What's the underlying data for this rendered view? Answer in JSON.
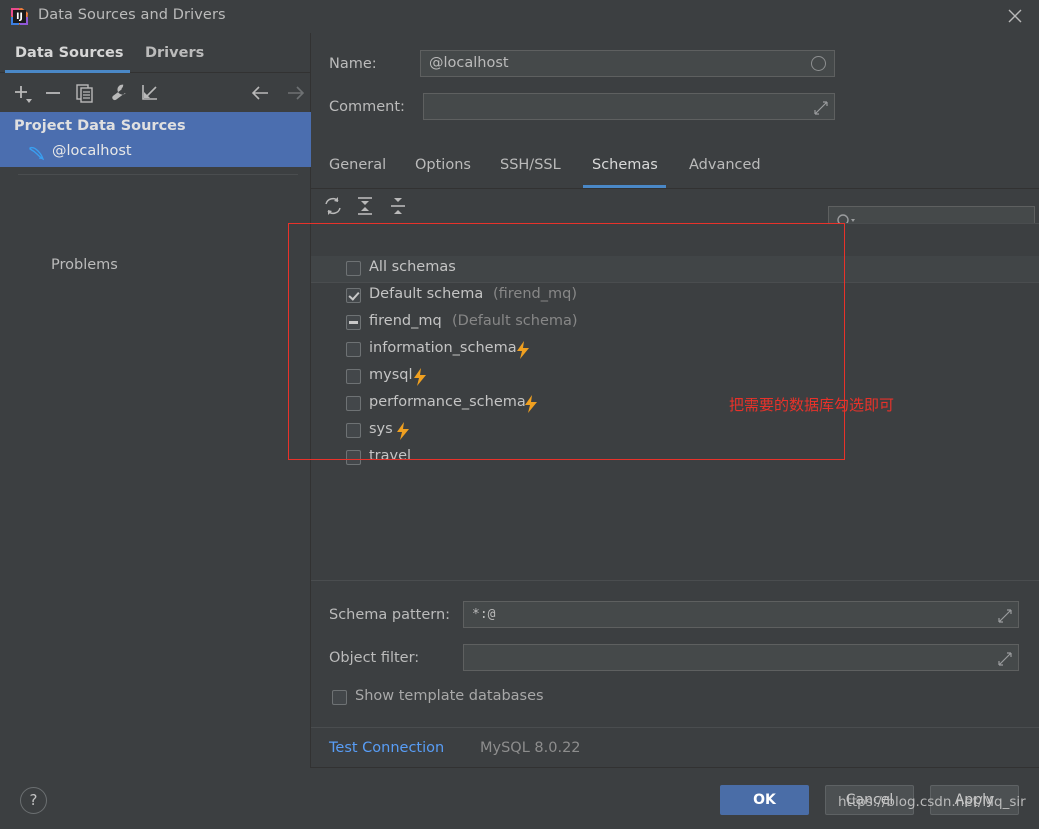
{
  "window": {
    "title": "Data Sources and Drivers",
    "app_icon": "intellij-idea-icon",
    "close_icon": "close-icon"
  },
  "sidebar": {
    "tabs": [
      {
        "label": "Data Sources",
        "selected": true
      },
      {
        "label": "Drivers",
        "selected": false
      }
    ],
    "toolbar": [
      {
        "name": "add-icon",
        "title": "Add"
      },
      {
        "name": "remove-icon",
        "title": "Remove"
      },
      {
        "name": "copy-icon",
        "title": "Duplicate"
      },
      {
        "name": "wrench-icon",
        "title": "Properties"
      },
      {
        "name": "import-icon",
        "title": "Import"
      },
      {
        "name": "arrow-left-icon",
        "title": "Back"
      },
      {
        "name": "arrow-right-icon",
        "title": "Forward"
      }
    ],
    "group_label": "Project Data Sources",
    "datasource": {
      "label": "@localhost",
      "icon": "mysql-dolphin-icon",
      "selected": true
    },
    "problems_label": "Problems"
  },
  "form": {
    "name_label": "Name:",
    "name_value": "@localhost",
    "comment_label": "Comment:",
    "comment_value": ""
  },
  "tabs": [
    {
      "label": "General",
      "selected": false
    },
    {
      "label": "Options",
      "selected": false
    },
    {
      "label": "SSH/SSL",
      "selected": false
    },
    {
      "label": "Schemas",
      "selected": true
    },
    {
      "label": "Advanced",
      "selected": false
    }
  ],
  "schemas_panel": {
    "toolbar": [
      {
        "name": "refresh-icon",
        "title": "Refresh"
      },
      {
        "name": "expand-all-icon",
        "title": "Expand All"
      },
      {
        "name": "collapse-all-icon",
        "title": "Collapse All"
      }
    ],
    "search_placeholder": "",
    "search_icon": "search-icon",
    "rows": [
      {
        "label": "All schemas",
        "sub": "",
        "state": "unchecked",
        "bolt": false,
        "header": true
      },
      {
        "label": "Default schema",
        "sub": "(firend_mq)",
        "state": "checked",
        "bolt": false,
        "header": false
      },
      {
        "label": "firend_mq",
        "sub": "(Default schema)",
        "state": "partial",
        "bolt": false,
        "header": false
      },
      {
        "label": "information_schema",
        "sub": "",
        "state": "unchecked",
        "bolt": true,
        "header": false
      },
      {
        "label": "mysql",
        "sub": "",
        "state": "unchecked",
        "bolt": true,
        "header": false
      },
      {
        "label": "performance_schema",
        "sub": "",
        "state": "unchecked",
        "bolt": true,
        "header": false
      },
      {
        "label": "sys",
        "sub": "",
        "state": "unchecked",
        "bolt": true,
        "header": false
      },
      {
        "label": "travel",
        "sub": "",
        "state": "unchecked",
        "bolt": false,
        "header": false
      }
    ]
  },
  "annotation": {
    "text": "把需要的数据库勾选即可",
    "color": "#e8322a"
  },
  "bottom_form": {
    "schema_pattern_label": "Schema pattern:",
    "schema_pattern_value": "*:@",
    "object_filter_label": "Object filter:",
    "object_filter_value": "",
    "show_template_label": "Show template databases",
    "show_template_checked": false
  },
  "footer": {
    "test_connection_label": "Test Connection",
    "driver_version": "MySQL 8.0.22"
  },
  "buttons": {
    "help": "?",
    "ok": "OK",
    "cancel": "Cancel",
    "apply": "Apply"
  },
  "watermark": "https://blog.csdn.net/Mq_sir",
  "colors": {
    "accent": "#4a88c7",
    "selection": "#4b6eaf",
    "link": "#589df6",
    "annotation": "#e8322a",
    "bolt": "#f0a020",
    "background": "#3c3f41"
  }
}
